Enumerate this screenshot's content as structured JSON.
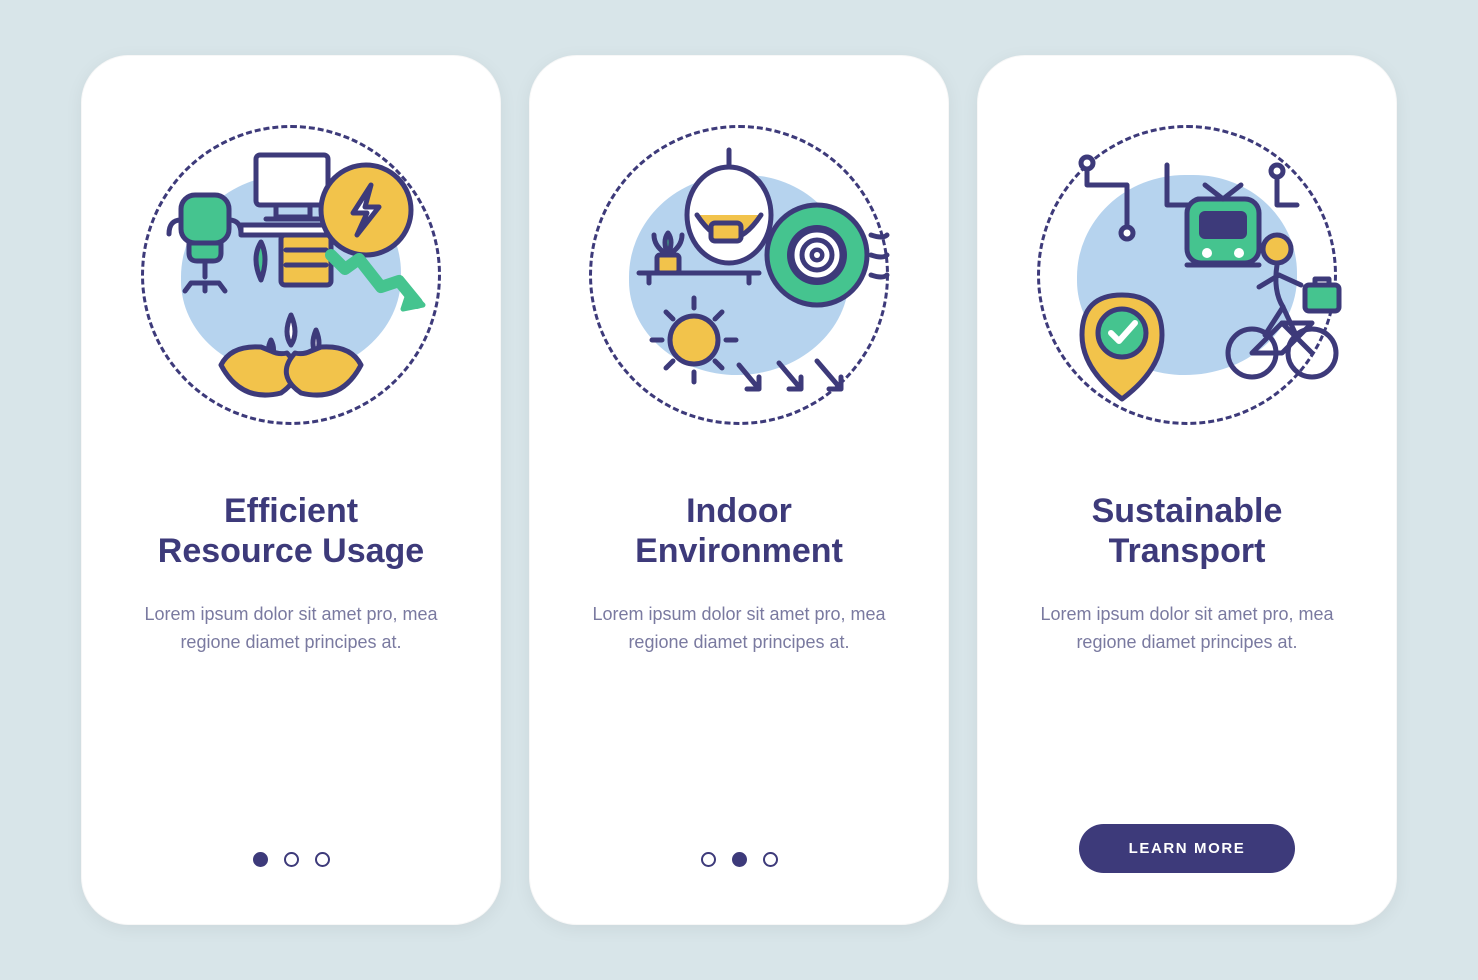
{
  "colors": {
    "stroke": "#3d3a7a",
    "accentBlue": "#b6d3ee",
    "green": "#45c48f",
    "yellow": "#f2c34b"
  },
  "screens": [
    {
      "icon": "resource-usage-icon",
      "title": "Efficient\nResource Usage",
      "body": "Lorem ipsum dolor sit amet pro, mea regione diamet principes at.",
      "dots": {
        "count": 3,
        "active": 0
      }
    },
    {
      "icon": "indoor-environment-icon",
      "title": "Indoor\nEnvironment",
      "body": "Lorem ipsum dolor sit amet pro, mea regione diamet principes at.",
      "dots": {
        "count": 3,
        "active": 1
      }
    },
    {
      "icon": "sustainable-transport-icon",
      "title": "Sustainable\nTransport",
      "body": "Lorem ipsum dolor sit amet pro, mea regione diamet principes at.",
      "cta": "LEARN MORE"
    }
  ]
}
